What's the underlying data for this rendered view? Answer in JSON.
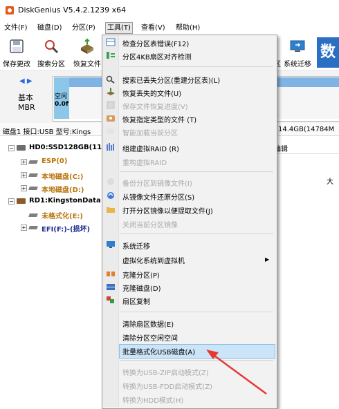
{
  "window": {
    "title": "DiskGenius V5.4.2.1239 x64"
  },
  "menubar": {
    "file": "文件(F)",
    "disk": "磁盘(D)",
    "partition": "分区(P)",
    "tools": "工具(T)",
    "view": "查看(V)",
    "help": "帮助(H)"
  },
  "toolbar": {
    "save": "保存更改",
    "search": "搜索分区",
    "recover": "恢复文件",
    "migrate": "系统迁移",
    "logo_char": "数"
  },
  "diskbar": {
    "basic": "基本",
    "mbr": "MBR",
    "esp_short": "空闲",
    "esp_size": "0.0f"
  },
  "infoline": {
    "left": "磁盘1 接口:USB  型号:Kings",
    "right": "14.4GB(14784M"
  },
  "tree": {
    "hd0": "HD0:SSD128GB(11",
    "esp": "ESP(0)",
    "local_c": "本地磁盘(C:)",
    "local_d": "本地磁盘(D:)",
    "rd1": "RD1:KingstonData",
    "unformatted": "未格式化(E:)",
    "efi": "EFI(F:)-(损坏)"
  },
  "right_panel": {
    "edit_tab": "编辑",
    "corner_char": "大"
  },
  "tools_menu": {
    "items": [
      {
        "label": "检查分区表错误(F12)",
        "disabled": false
      },
      {
        "label": "分区4KB扇区对齐检测",
        "disabled": false
      },
      {
        "label": "搜索已丢失分区(重建分区表)(L)",
        "disabled": false
      },
      {
        "label": "恢复丢失的文件(U)",
        "disabled": false
      },
      {
        "label": "保存文件恢复进度(V)",
        "disabled": true
      },
      {
        "label": "恢复指定类型的文件 (T)",
        "disabled": false
      },
      {
        "label": "智能加载当前分区",
        "disabled": true
      },
      {
        "label": "组建虚拟RAID (R)",
        "disabled": false
      },
      {
        "label": "重构虚拟RAID",
        "disabled": true
      },
      {
        "label": "备份分区到镜像文件(I)",
        "disabled": true
      },
      {
        "label": "从镜像文件还原分区(S)",
        "disabled": false
      },
      {
        "label": "打开分区镜像以便提取文件(J)",
        "disabled": false
      },
      {
        "label": "关闭当前分区镜像",
        "disabled": true
      },
      {
        "label": "系统迁移",
        "disabled": false
      },
      {
        "label": "虚拟化系统到虚拟机",
        "disabled": false
      },
      {
        "label": "克隆分区(P)",
        "disabled": false
      },
      {
        "label": "克隆磁盘(D)",
        "disabled": false
      },
      {
        "label": "扇区复制",
        "disabled": false
      },
      {
        "label": "清除扇区数据(E)",
        "disabled": false
      },
      {
        "label": "清除分区空闲空间",
        "disabled": false
      },
      {
        "label": "批量格式化USB磁盘(A)",
        "disabled": false,
        "highlighted": true
      },
      {
        "label": "转换为USB-ZIP启动模式(Z)",
        "disabled": true
      },
      {
        "label": "转换为USB-FDD启动模式(Z)",
        "disabled": true
      },
      {
        "label": "转换为HDD模式(H)",
        "disabled": true
      }
    ]
  },
  "colors": {
    "accent_highlight": "#cce4f7",
    "annotation_arrow": "#e53935"
  }
}
